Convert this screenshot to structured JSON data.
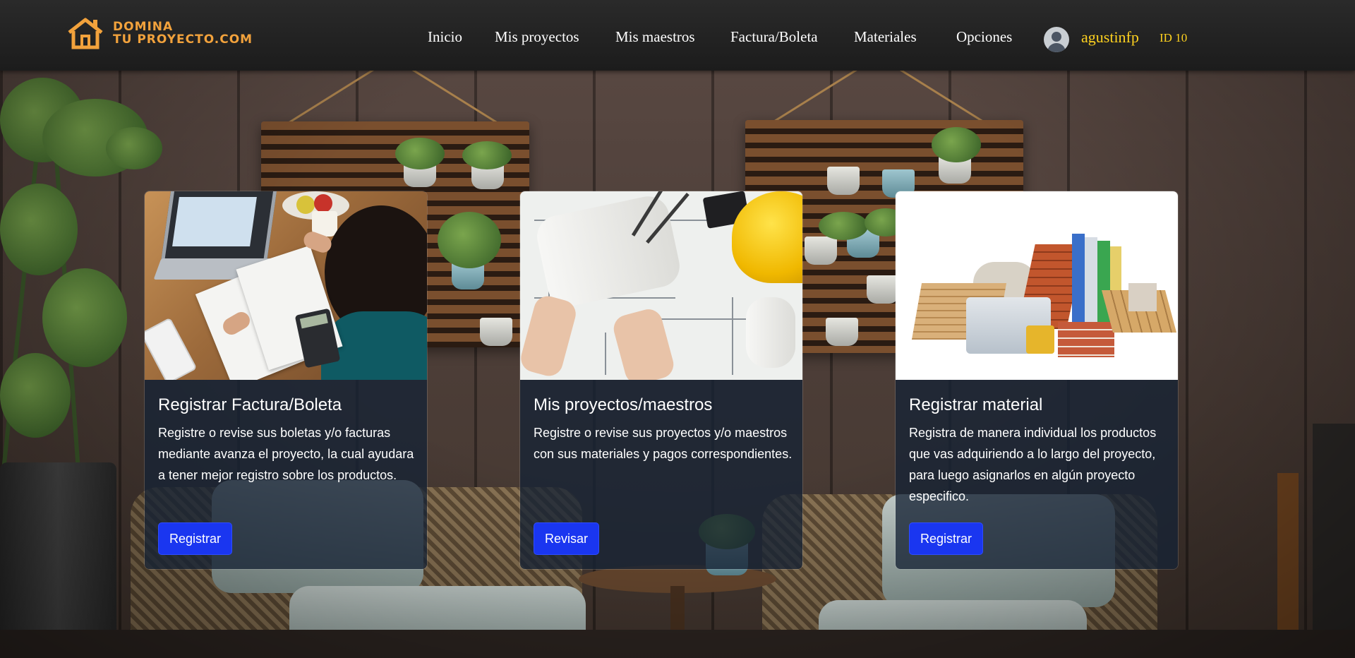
{
  "brand": {
    "line1": "DOMINA",
    "line2": "TU PROYECTO.COM",
    "logo_icon": "house-icon",
    "accent": "#f2a23c"
  },
  "nav": {
    "items": [
      {
        "label": "Inicio"
      },
      {
        "label": "Mis proyectos"
      },
      {
        "label": "Mis maestros"
      },
      {
        "label": "Factura/Boleta"
      },
      {
        "label": "Materiales"
      },
      {
        "label": "Opciones"
      }
    ],
    "user": {
      "avatar_icon": "user-avatar-icon",
      "name": "agustinfp",
      "id": "ID 10",
      "color": "#ffd21f"
    }
  },
  "cards": [
    {
      "image": "invoice-desk-photo",
      "title": "Registrar Factura/Boleta",
      "text": "Registre o revise sus boletas y/o facturas mediante avanza el proyecto, la cual ayudara a tener mejor registro sobre los productos.",
      "button": "Registrar"
    },
    {
      "image": "blueprints-helmet-photo",
      "title": "Mis proyectos/maestros",
      "text": "Registre o revise sus proyectos y/o maestros con sus materiales y pagos correspondientes.",
      "button": "Revisar"
    },
    {
      "image": "construction-materials-photo",
      "title": "Registrar material",
      "text": "Registra de manera individual los productos que vas adquiriendo a lo largo del proyecto, para luego asignarlos en algún proyecto especifico.",
      "button": "Registrar"
    }
  ],
  "colors": {
    "button": "#1a36f0",
    "card_body": "rgba(22,34,52,0.78)",
    "navbar": "#222222"
  }
}
